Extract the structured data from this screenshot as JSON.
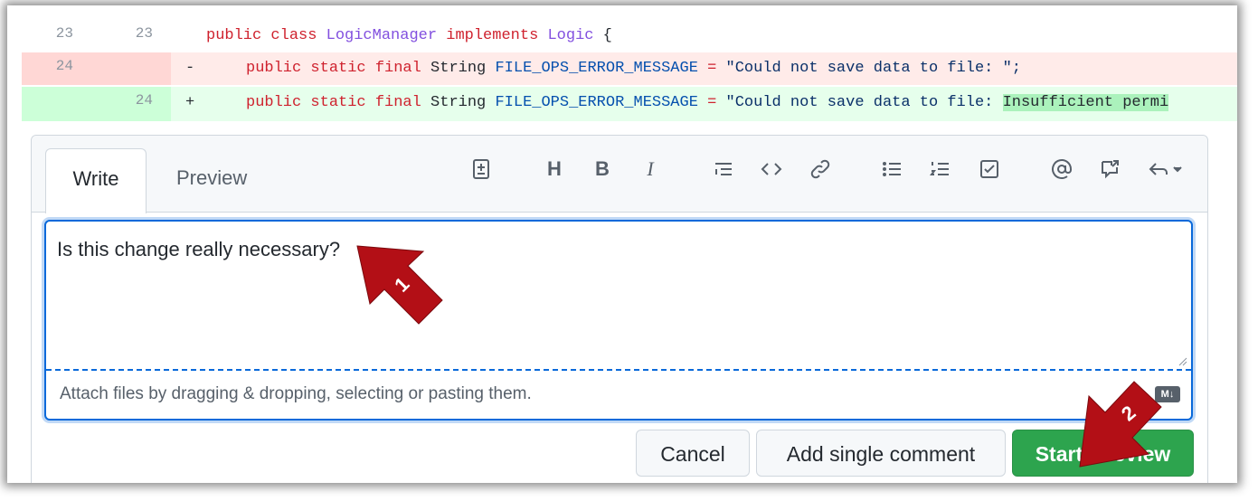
{
  "diff": {
    "context_row": {
      "old_line": "23",
      "new_line": "23",
      "code_keyword": "public class ",
      "code_class": "LogicManager",
      "code_implements": " implements ",
      "code_iface": "Logic",
      "code_rest": " {"
    },
    "deleted_row": {
      "old_line": "24",
      "sign": "-",
      "code_keyword": "public static final",
      "code_type": " String ",
      "code_const": "FILE_OPS_ERROR_MESSAGE",
      "code_op": " = ",
      "code_string": "\"Could not save data to file: \";"
    },
    "added_row": {
      "new_line": "24",
      "sign": "+",
      "code_keyword": "public static final",
      "code_type": " String ",
      "code_const": "FILE_OPS_ERROR_MESSAGE",
      "code_op": " = ",
      "code_string": "\"Could not save data to file: ",
      "code_highlight": "Insufficient permi"
    }
  },
  "comment_box": {
    "tabs": {
      "write": "Write",
      "preview": "Preview"
    },
    "toolbar_icons": [
      "diff-icon",
      "heading-icon",
      "bold-icon",
      "italic-icon",
      "quote-icon",
      "code-icon",
      "link-icon",
      "bullet-list-icon",
      "numbered-list-icon",
      "task-list-icon",
      "mention-icon",
      "cross-reference-icon",
      "reply-icon"
    ],
    "toolbar_labels": {
      "heading": "H",
      "bold": "B",
      "italic": "I"
    },
    "text_value": "Is this change really necessary?",
    "attach_hint": "Attach files by dragging & dropping, selecting or pasting them.",
    "markdown_badge": "M↓"
  },
  "buttons": {
    "cancel": "Cancel",
    "add_single": "Add single comment",
    "start_review": "Start a review"
  },
  "annotations": {
    "step1": "1",
    "step2": "2",
    "arrow_color": "#b30f16"
  }
}
